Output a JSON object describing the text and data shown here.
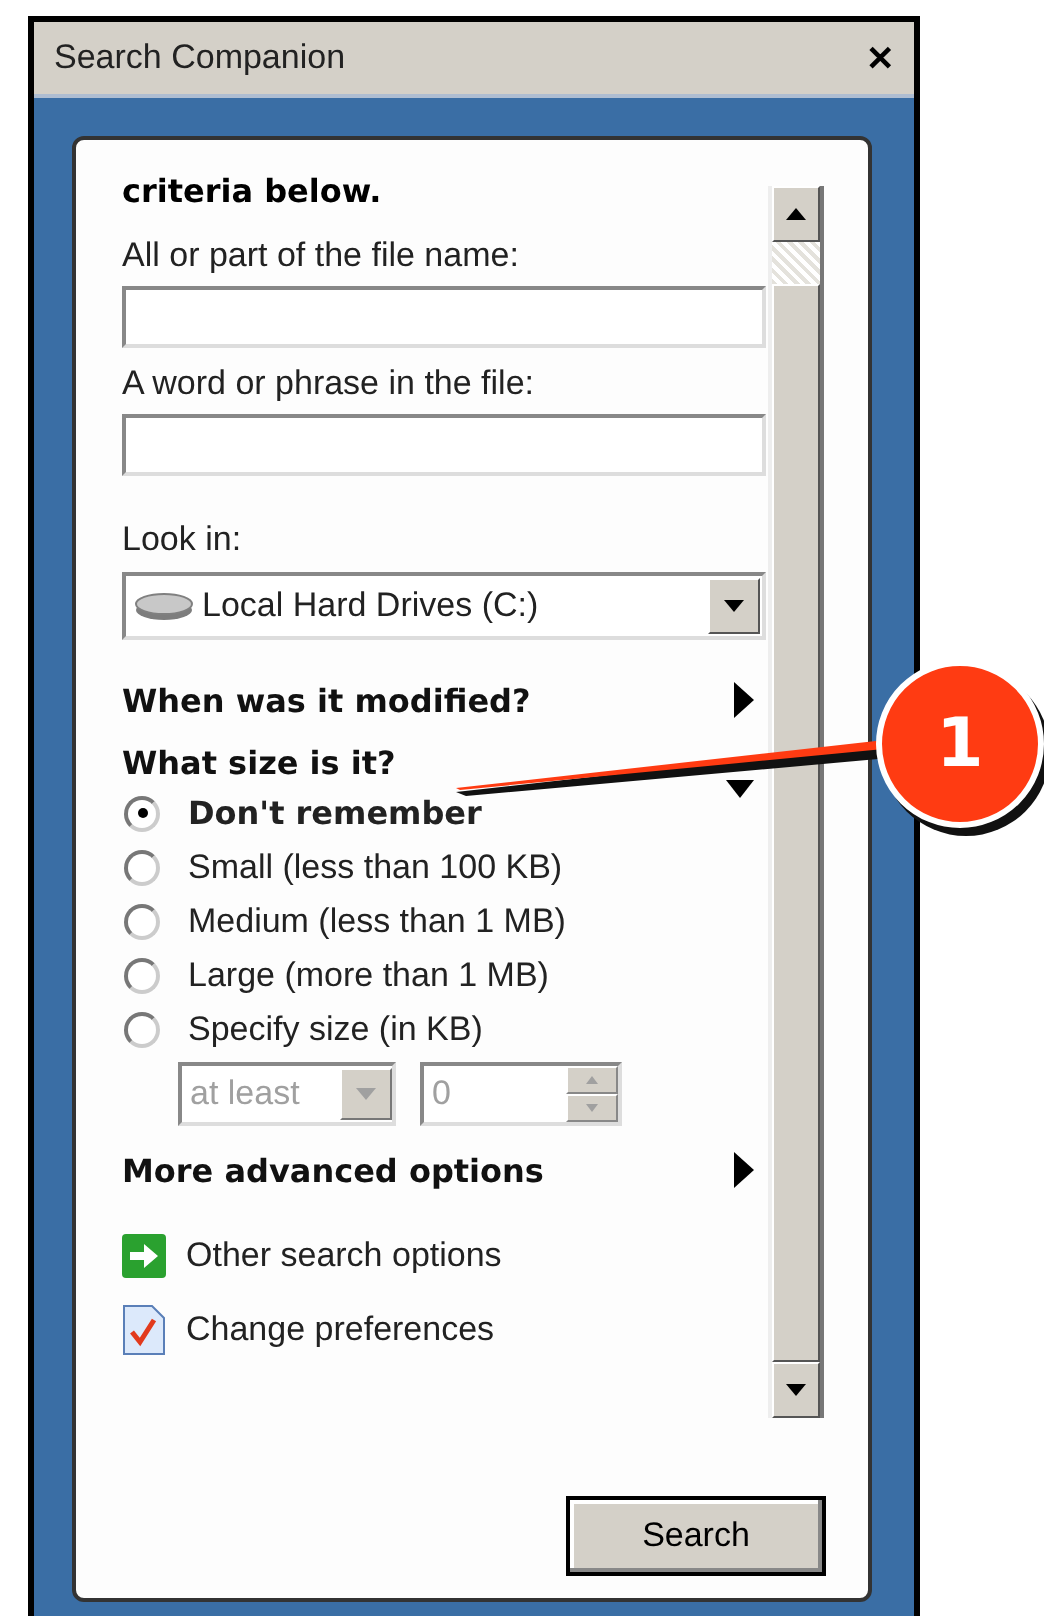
{
  "window": {
    "title": "Search Companion",
    "close": "✕"
  },
  "intro": "criteria below.",
  "fields": [
    {
      "label": "All or part of the file name:"
    },
    {
      "label": "A word or phrase in the file:"
    }
  ],
  "look_in": {
    "label": "Look in:",
    "value": "Local Hard Drives (C:)"
  },
  "sections": [
    {
      "title": "When was it modified?",
      "expanded": false
    },
    {
      "title": "What size is it?",
      "expanded": true,
      "options": [
        {
          "label": "Don't remember",
          "selected": true
        },
        {
          "label": "Small (less than 100 KB)",
          "selected": false
        },
        {
          "label": "Medium (less than 1 MB)",
          "selected": false
        },
        {
          "label": "Large (more than 1 MB)",
          "selected": false
        },
        {
          "label": "Specify size (in KB)",
          "selected": false
        }
      ],
      "size_filter": {
        "comparison": "at least",
        "amount": "0",
        "disabled": true
      }
    },
    {
      "title": "More advanced options",
      "expanded": false
    }
  ],
  "links": [
    {
      "label": "Other search options",
      "kind": "arrow"
    },
    {
      "label": "Change preferences",
      "kind": "preferences"
    }
  ],
  "search_button": "Search",
  "callout": {
    "number": "1"
  }
}
